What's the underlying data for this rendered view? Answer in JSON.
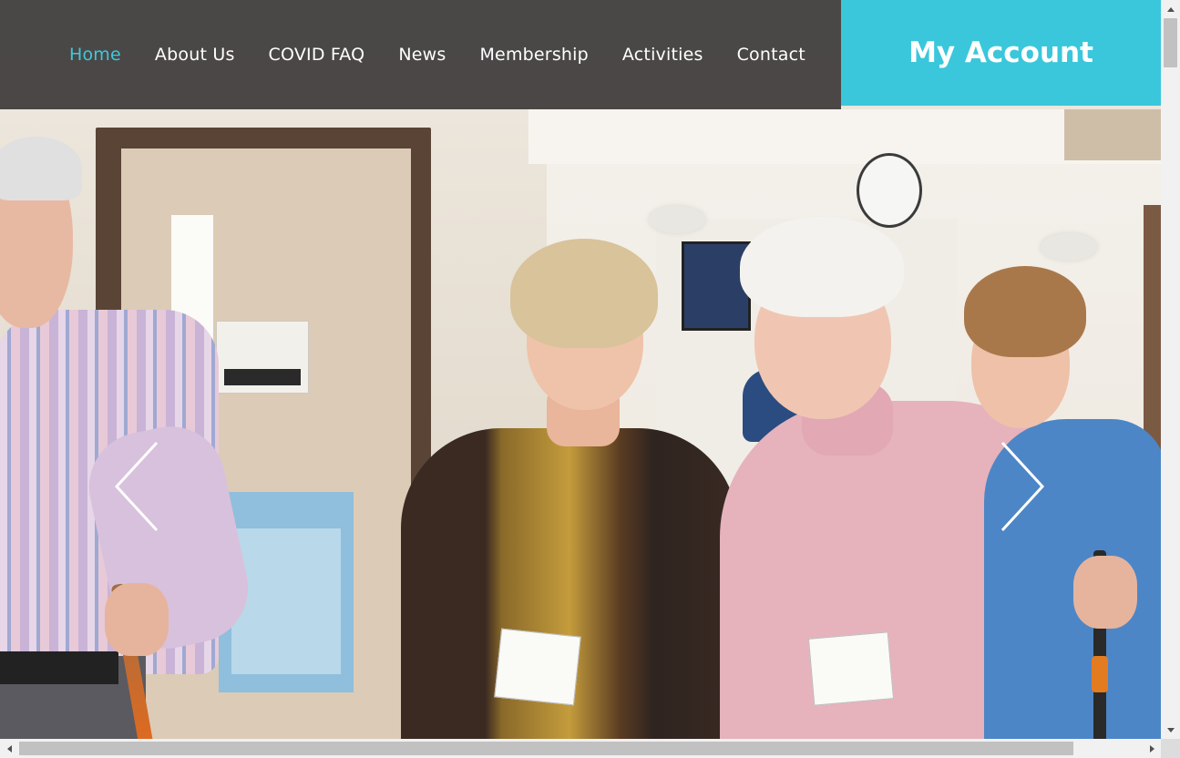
{
  "nav": {
    "items": [
      {
        "label": "Home",
        "active": true
      },
      {
        "label": "About Us",
        "active": false
      },
      {
        "label": "COVID FAQ",
        "active": false
      },
      {
        "label": "News",
        "active": false
      },
      {
        "label": "Membership",
        "active": false
      },
      {
        "label": "Activities",
        "active": false
      },
      {
        "label": "Contact",
        "active": false
      }
    ]
  },
  "account": {
    "label": "My Account"
  },
  "hero": {
    "icons": {
      "prev": "chevron-left-icon",
      "next": "chevron-right-icon"
    }
  },
  "colors": {
    "accent": "#3ac7db",
    "header_bg": "#3c3a38",
    "nav_text": "#ffffff",
    "nav_active": "#3fc8dc"
  }
}
